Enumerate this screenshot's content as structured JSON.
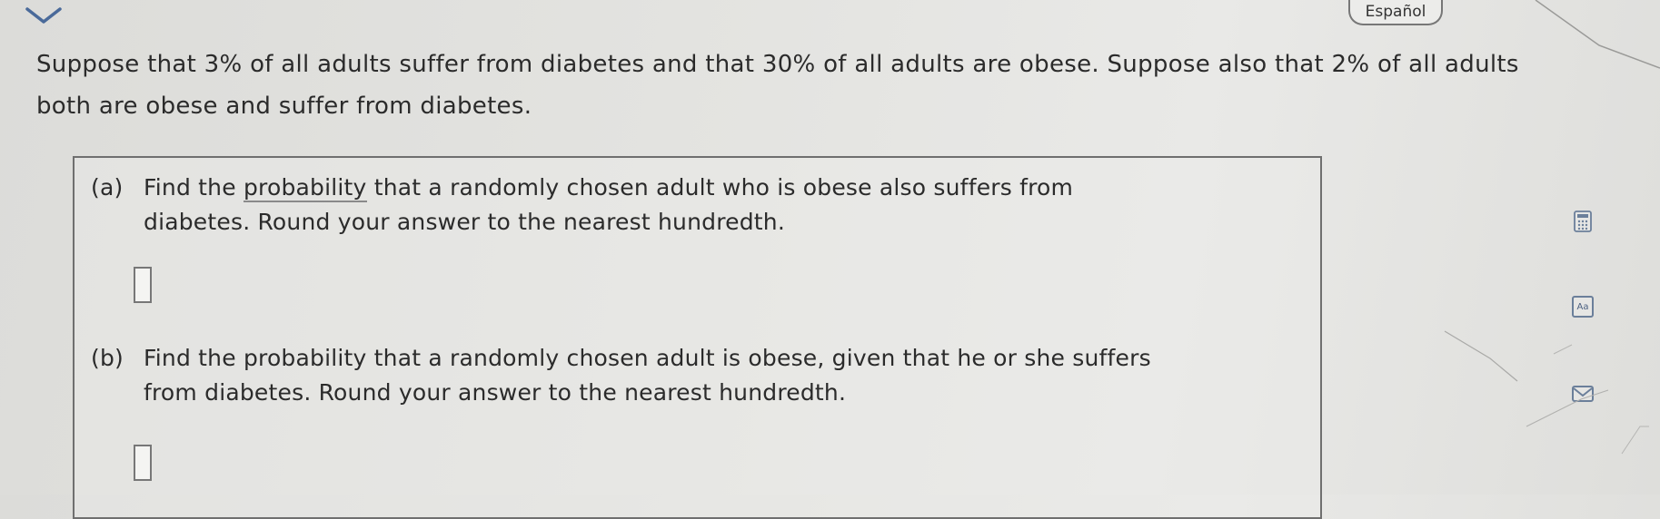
{
  "header": {
    "language_label": "Español"
  },
  "problem": {
    "intro_line1": "Suppose that 3% of all adults suffer from diabetes and that 30% of all adults are obese. Suppose also that 2% of all adults",
    "intro_line2": "both are obese and suffer from diabetes."
  },
  "parts": [
    {
      "tag": "(a)",
      "line1_before": "Find the ",
      "line1_link": "probability",
      "line1_after": " that a randomly chosen adult who is obese also suffers from",
      "line2": "diabetes. Round your answer to the nearest hundredth.",
      "answer_value": ""
    },
    {
      "tag": "(b)",
      "line1": "Find the probability that a randomly chosen adult is obese, given that he or she suffers",
      "line2": "from diabetes. Round your answer to the nearest hundredth.",
      "answer_value": ""
    }
  ],
  "tools": [
    {
      "icon": "calculator-icon"
    },
    {
      "icon": "text-size-icon",
      "label": "Aa"
    },
    {
      "icon": "mail-icon"
    }
  ]
}
